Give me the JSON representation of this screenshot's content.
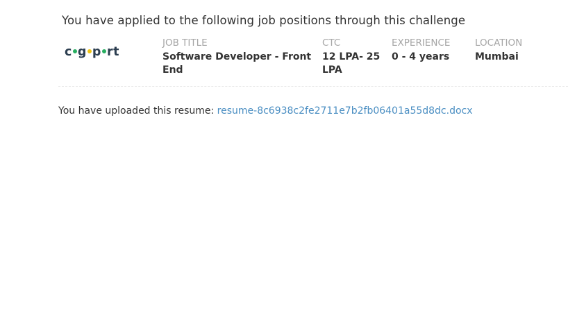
{
  "heading": "You have applied to the following job positions through this challenge",
  "company": {
    "logo_text_1": "c",
    "logo_text_2": "g",
    "logo_text_3": "p",
    "logo_text_4": "rt",
    "logo_dot_colors": [
      "#27ae60",
      "#f1c40f",
      "#27ae60"
    ]
  },
  "job": {
    "title_label": "JOB TITLE",
    "title_value": "Software Developer - Front End",
    "ctc_label": "CTC",
    "ctc_value": "12 LPA- 25 LPA",
    "experience_label": "EXPERIENCE",
    "experience_value": "0 - 4 years",
    "location_label": "LOCATION",
    "location_value": "Mumbai"
  },
  "resume": {
    "prefix": "You have uploaded this resume: ",
    "filename": "resume-8c6938c2fe2711e7b2fb06401a55d8dc.docx"
  }
}
